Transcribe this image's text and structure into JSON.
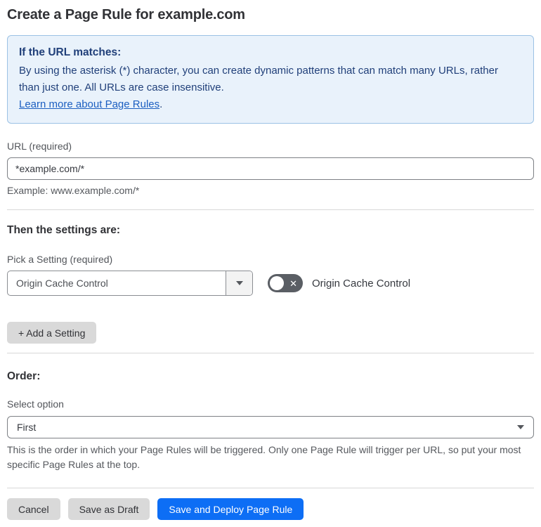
{
  "page": {
    "title": "Create a Page Rule for example.com"
  },
  "info_box": {
    "heading": "If the URL matches:",
    "body": "By using the asterisk (*) character, you can create dynamic patterns that can match many URLs, rather than just one. All URLs are case insensitive.",
    "link": "Learn more about Page Rules",
    "link_suffix": "."
  },
  "url_section": {
    "label": "URL (required)",
    "value": "*example.com/*",
    "helper": "Example: www.example.com/*"
  },
  "settings_section": {
    "heading": "Then the settings are:",
    "pick_label": "Pick a Setting (required)",
    "selected_setting": "Origin Cache Control",
    "toggle_label": "Origin Cache Control",
    "toggle_state": "off",
    "toggle_off_glyph": "✕",
    "add_setting_label": "+ Add a Setting"
  },
  "order_section": {
    "heading": "Order:",
    "label": "Select option",
    "selected_option": "First",
    "helper": "This is the order in which your Page Rules will be triggered. Only one Page Rule will trigger per URL, so put your most specific Page Rules at the top."
  },
  "footer": {
    "cancel_label": "Cancel",
    "save_draft_label": "Save as Draft",
    "save_deploy_label": "Save and Deploy Page Rule"
  },
  "colors": {
    "accent_blue": "#0d6ef5",
    "info_box_bg": "#e9f2fb",
    "info_box_border": "#9cc2e5",
    "info_text": "#21407a",
    "link_blue": "#1c5fc1",
    "button_gray": "#d9d9d9",
    "toggle_off_bg": "#5a5e64"
  }
}
